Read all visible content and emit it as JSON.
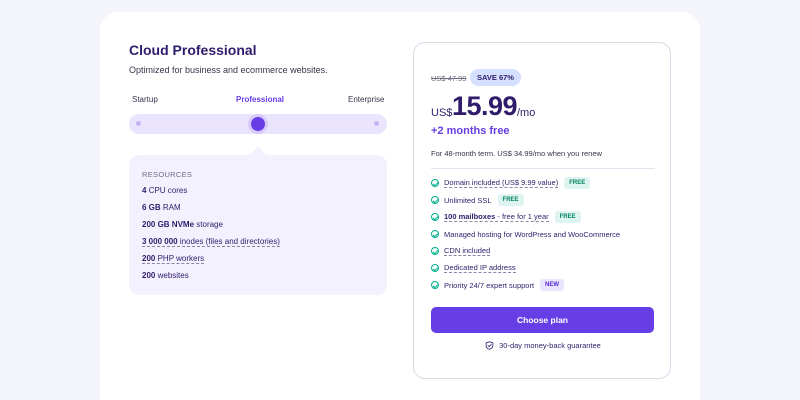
{
  "plan": {
    "title": "Cloud Professional",
    "subtitle": "Optimized for business and ecommerce websites."
  },
  "tiers": {
    "items": [
      "Startup",
      "Professional",
      "Enterprise"
    ],
    "selected": "Professional"
  },
  "resources": {
    "heading": "RESOURCES",
    "cpu": {
      "value": "4",
      "label": "CPU cores"
    },
    "ram": {
      "value": "6 GB",
      "label": "RAM"
    },
    "storage": {
      "value": "200 GB NVMe",
      "label": "storage"
    },
    "inodes": {
      "value": "3 000 000",
      "label": "inodes (files and directories)"
    },
    "php": {
      "value": "200",
      "label": "PHP workers"
    },
    "websites": {
      "value": "200",
      "label": "websites"
    }
  },
  "pricing": {
    "old_price": "US$ 47.99",
    "save_badge": "SAVE 67%",
    "currency": "US$",
    "amount": "15.99",
    "period": "/mo",
    "bonus": "+2 months free",
    "term": "For 48-month term. US$ 34.99/mo when you renew"
  },
  "features": {
    "domain": {
      "text": "Domain included (US$ 9.99 value)",
      "tag": "FREE"
    },
    "ssl": {
      "text": "Unlimited SSL",
      "tag": "FREE"
    },
    "mailboxes": {
      "bold": "100 mailboxes",
      "text": " - free for 1 year",
      "tag": "FREE"
    },
    "managed": {
      "text": "Managed hosting for WordPress and WooCommerce"
    },
    "cdn": {
      "text": "CDN included"
    },
    "ip": {
      "text": "Dedicated IP address"
    },
    "support": {
      "text": "Priority 24/7 expert support",
      "tag": "NEW"
    }
  },
  "cta": {
    "label": "Choose plan"
  },
  "guarantee": {
    "text": "30-day money-back guarantee",
    "icon": "shield-check-icon"
  },
  "colors": {
    "accent": "#673de6",
    "heading": "#2f1c6a",
    "check": "#00b090",
    "free_tag_bg": "#def4f0",
    "new_tag_bg": "#ebe4ff",
    "save_badge_bg": "#d5dfff"
  }
}
